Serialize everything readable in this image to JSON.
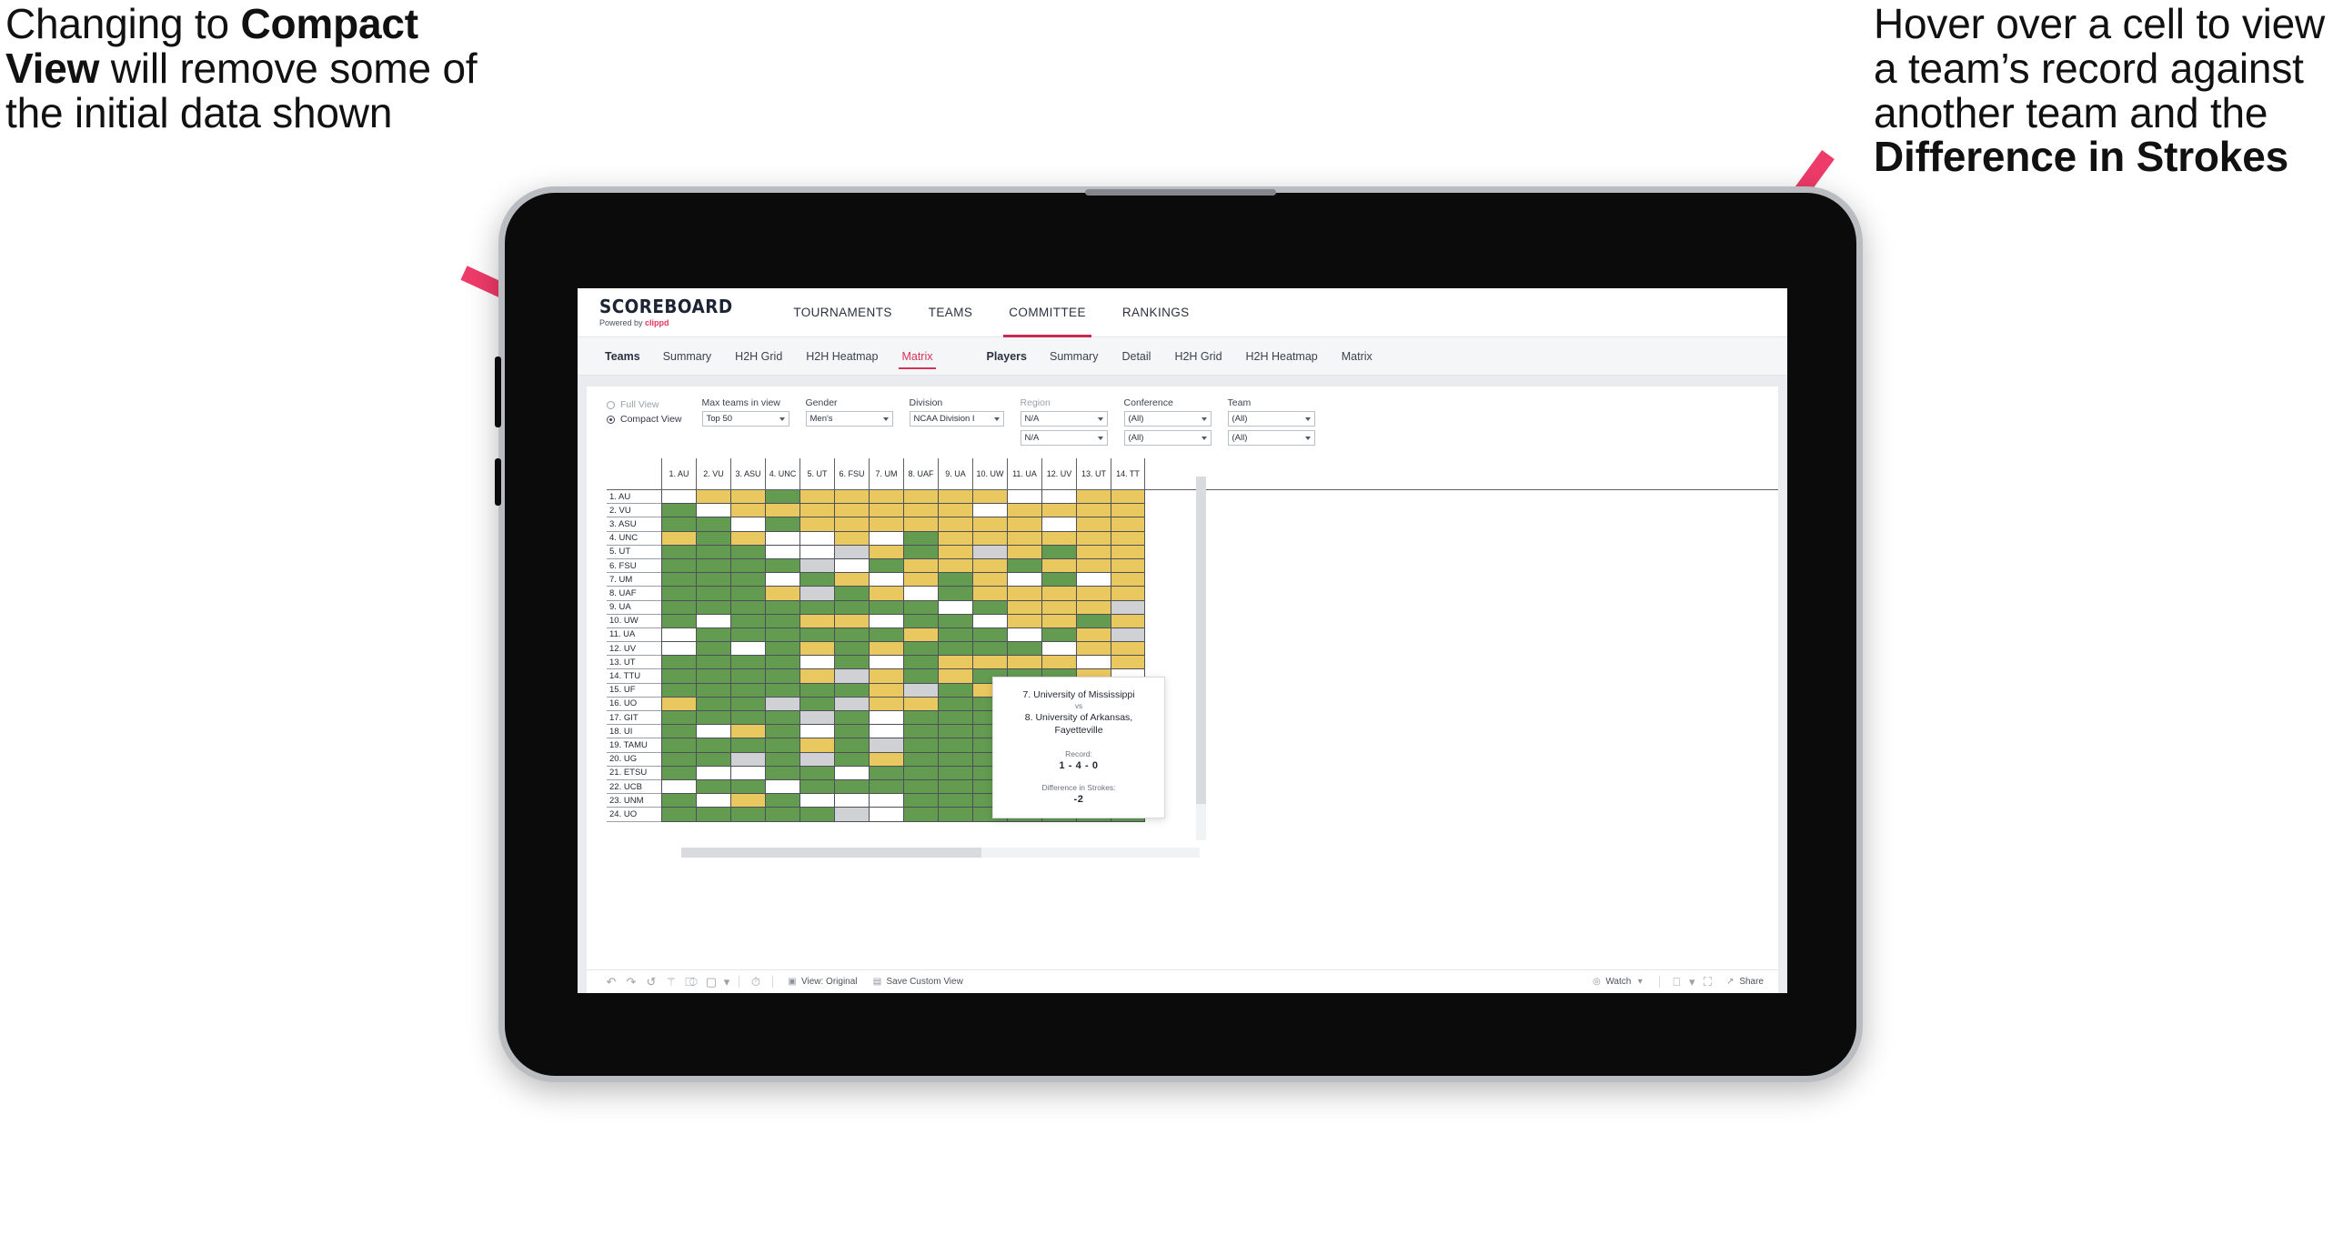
{
  "annotations": {
    "left": {
      "pre": "Changing to ",
      "bold": "Compact View",
      "post": " will remove some of the initial data shown"
    },
    "right": {
      "pre": "Hover over a cell to view a team’s record against another team and the ",
      "bold": "Difference in Strokes",
      "post": ""
    }
  },
  "brand": {
    "title": "SCOREBOARD",
    "powered_prefix": "Powered by ",
    "powered_name": "clippd"
  },
  "topnav": {
    "items": [
      "TOURNAMENTS",
      "TEAMS",
      "COMMITTEE",
      "RANKINGS"
    ],
    "active": "COMMITTEE"
  },
  "subnav": {
    "teams_label": "Teams",
    "teams_items": [
      "Summary",
      "H2H Grid",
      "H2H Heatmap",
      "Matrix"
    ],
    "teams_active": "Matrix",
    "players_label": "Players",
    "players_items": [
      "Summary",
      "Detail",
      "H2H Grid",
      "H2H Heatmap",
      "Matrix"
    ]
  },
  "filters": {
    "view_mode": {
      "full": "Full View",
      "compact": "Compact View",
      "selected": "Compact View"
    },
    "fields": [
      {
        "label": "Max teams in view",
        "value": "Top 50",
        "muted": false,
        "second": null
      },
      {
        "label": "Gender",
        "value": "Men's",
        "muted": false,
        "second": null
      },
      {
        "label": "Division",
        "value": "NCAA Division I",
        "muted": false,
        "second": null
      },
      {
        "label": "Region",
        "value": "N/A",
        "muted": true,
        "second": "N/A"
      },
      {
        "label": "Conference",
        "value": "(All)",
        "muted": false,
        "second": "(All)"
      },
      {
        "label": "Team",
        "value": "(All)",
        "muted": false,
        "second": "(All)"
      }
    ]
  },
  "matrix": {
    "columns": [
      "1. AU",
      "2. VU",
      "3. ASU",
      "4. UNC",
      "5. UT",
      "6. FSU",
      "7. UM",
      "8. UAF",
      "9. UA",
      "10. UW",
      "11. UA",
      "12. UV",
      "13. UT",
      "14. TT"
    ],
    "rows": [
      "1. AU",
      "2. VU",
      "3. ASU",
      "4. UNC",
      "5. UT",
      "6. FSU",
      "7. UM",
      "8. UAF",
      "9. UA",
      "10. UW",
      "11. UA",
      "12. UV",
      "13. UT",
      "14. TTU",
      "15. UF",
      "16. UO",
      "17. GIT",
      "18. UI",
      "19. TAMU",
      "20. UG",
      "21. ETSU",
      "22. UCB",
      "23. UNM",
      "24. UO"
    ],
    "legend_colors": {
      "win": "#639b51",
      "loss": "#e9c85f",
      "none": "#ffffff",
      "tie": "#cfd1d4"
    },
    "cells": [
      [
        "w",
        "y",
        "y",
        "g",
        "y",
        "y",
        "y",
        "y",
        "y",
        "y",
        "w",
        "w",
        "y",
        "y"
      ],
      [
        "g",
        "w",
        "y",
        "y",
        "y",
        "y",
        "y",
        "y",
        "y",
        "w",
        "y",
        "y",
        "y",
        "y"
      ],
      [
        "g",
        "g",
        "w",
        "g",
        "y",
        "y",
        "y",
        "y",
        "y",
        "y",
        "y",
        "w",
        "y",
        "y"
      ],
      [
        "y",
        "g",
        "y",
        "w",
        "w",
        "y",
        "w",
        "g",
        "y",
        "y",
        "y",
        "y",
        "y",
        "y"
      ],
      [
        "g",
        "g",
        "g",
        "w",
        "w",
        "a",
        "y",
        "g",
        "y",
        "a",
        "y",
        "g",
        "y",
        "y"
      ],
      [
        "g",
        "g",
        "g",
        "g",
        "a",
        "w",
        "g",
        "y",
        "y",
        "y",
        "g",
        "y",
        "y",
        "y"
      ],
      [
        "g",
        "g",
        "g",
        "w",
        "g",
        "y",
        "w",
        "y",
        "g",
        "y",
        "w",
        "g",
        "w",
        "y"
      ],
      [
        "g",
        "g",
        "g",
        "y",
        "a",
        "g",
        "y",
        "w",
        "g",
        "y",
        "y",
        "y",
        "y",
        "y"
      ],
      [
        "g",
        "g",
        "g",
        "g",
        "g",
        "g",
        "g",
        "g",
        "w",
        "g",
        "y",
        "y",
        "y",
        "a"
      ],
      [
        "g",
        "w",
        "g",
        "g",
        "y",
        "y",
        "w",
        "g",
        "g",
        "w",
        "y",
        "y",
        "g",
        "y"
      ],
      [
        "w",
        "g",
        "g",
        "g",
        "g",
        "g",
        "g",
        "y",
        "g",
        "g",
        "w",
        "g",
        "y",
        "a"
      ],
      [
        "w",
        "g",
        "w",
        "g",
        "y",
        "g",
        "y",
        "g",
        "g",
        "g",
        "g",
        "w",
        "y",
        "y"
      ],
      [
        "g",
        "g",
        "g",
        "g",
        "w",
        "g",
        "w",
        "g",
        "y",
        "y",
        "y",
        "y",
        "w",
        "y"
      ],
      [
        "g",
        "g",
        "g",
        "g",
        "y",
        "a",
        "y",
        "g",
        "y",
        "g",
        "g",
        "g",
        "y",
        "w"
      ],
      [
        "g",
        "g",
        "g",
        "g",
        "g",
        "g",
        "y",
        "a",
        "g",
        "y",
        "g",
        "g",
        "g",
        "g"
      ],
      [
        "y",
        "g",
        "g",
        "a",
        "g",
        "a",
        "y",
        "y",
        "g",
        "g",
        "g",
        "g",
        "g",
        "g"
      ],
      [
        "g",
        "g",
        "g",
        "g",
        "a",
        "g",
        "w",
        "g",
        "g",
        "g",
        "g",
        "g",
        "g",
        "g"
      ],
      [
        "g",
        "w",
        "y",
        "g",
        "w",
        "g",
        "w",
        "g",
        "g",
        "g",
        "g",
        "g",
        "g",
        "g"
      ],
      [
        "g",
        "g",
        "g",
        "g",
        "y",
        "g",
        "a",
        "g",
        "g",
        "g",
        "g",
        "g",
        "g",
        "g"
      ],
      [
        "g",
        "g",
        "a",
        "g",
        "a",
        "g",
        "y",
        "g",
        "g",
        "g",
        "g",
        "g",
        "g",
        "g"
      ],
      [
        "g",
        "w",
        "w",
        "g",
        "g",
        "w",
        "g",
        "g",
        "g",
        "g",
        "g",
        "g",
        "g",
        "g"
      ],
      [
        "w",
        "g",
        "g",
        "w",
        "g",
        "g",
        "g",
        "g",
        "g",
        "g",
        "g",
        "g",
        "g",
        "g"
      ],
      [
        "g",
        "w",
        "y",
        "g",
        "w",
        "w",
        "w",
        "g",
        "g",
        "g",
        "g",
        "g",
        "g",
        "g"
      ],
      [
        "g",
        "g",
        "g",
        "g",
        "g",
        "a",
        "w",
        "g",
        "g",
        "g",
        "g",
        "g",
        "g",
        "g"
      ]
    ]
  },
  "tooltip": {
    "team_a": "7. University of Mississippi",
    "vs": "vs",
    "team_b": "8. University of Arkansas, Fayetteville",
    "record_label": "Record:",
    "record_value": "1 - 4 - 0",
    "diff_label": "Difference in Strokes:",
    "diff_value": "-2"
  },
  "toolbar": {
    "icons": [
      "undo-icon",
      "redo-icon",
      "revert-icon",
      "refresh-icon",
      "pause-icon",
      "highlight-icon"
    ],
    "view_original": "View: Original",
    "save_custom_view": "Save Custom View",
    "watch": "Watch",
    "share": "Share"
  }
}
